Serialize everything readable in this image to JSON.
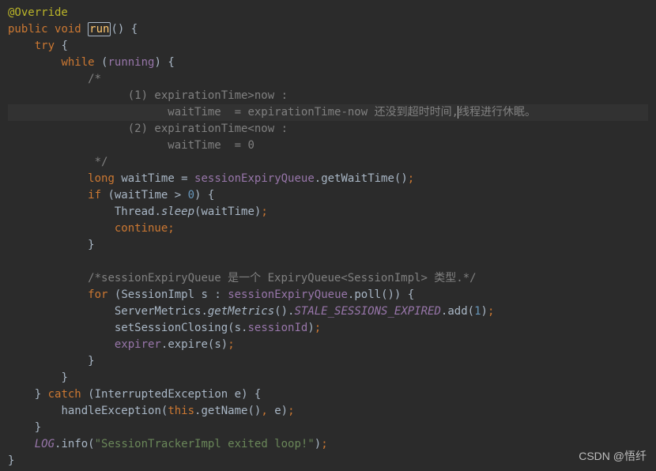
{
  "code": {
    "annotation": "@Override",
    "modifier_public": "public",
    "ret_void": "void",
    "method_name": "run",
    "kw_try": "try",
    "kw_while": "while",
    "cond_running": "running",
    "cmt_open": "/*",
    "cmt_l1": "(1) expirationTime>now :",
    "cmt_l2_a": "waitTime  = expirationTime-now 还没到超时时间,",
    "cmt_l2_b": "线程进行休眠。",
    "cmt_l3": "(2) expirationTime<now :",
    "cmt_l4": "waitTime  = 0",
    "cmt_close": " */",
    "kw_long": "long",
    "var_waitTime": "waitTime",
    "eq": " = ",
    "sessionExpiryQueue": "sessionExpiryQueue",
    "getWaitTime": "getWaitTime",
    "kw_if": "if",
    "gt": " > ",
    "zero": "0",
    "Thread": "Thread",
    "sleep": "sleep",
    "kw_continue": "continue",
    "cmt_sessionExpiry": "/*sessionExpiryQueue 是一个 ExpiryQueue<SessionImpl> 类型.*/",
    "kw_for": "for",
    "SessionImpl": "SessionImpl",
    "var_s": "s",
    "colon": " : ",
    "poll": "poll",
    "ServerMetrics": "ServerMetrics",
    "getMetrics": "getMetrics",
    "STALE": "STALE_SESSIONS_EXPIRED",
    "add": "add",
    "one": "1",
    "setSessionClosing": "setSessionClosing",
    "sessionId": "sessionId",
    "expirer": "expirer",
    "expire": "expire",
    "kw_catch": "catch",
    "InterruptedException": "InterruptedException",
    "var_e": "e",
    "handleException": "handleException",
    "kw_this": "this",
    "getName": "getName",
    "LOG": "LOG",
    "info": "info",
    "log_msg": "\"SessionTrackerImpl exited loop!\""
  },
  "watermark": "CSDN @悟纤"
}
